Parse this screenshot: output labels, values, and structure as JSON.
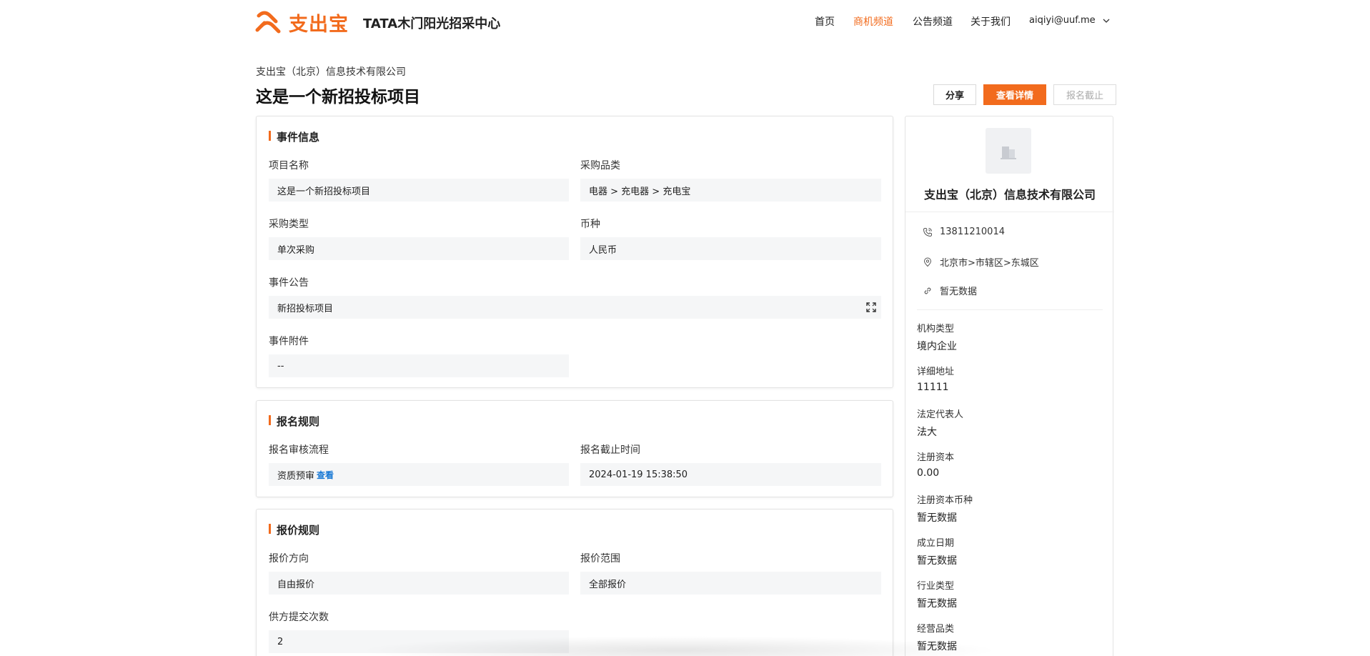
{
  "header": {
    "logo_text": "支出宝",
    "site_title": "TATA木门阳光招采中心",
    "nav": [
      {
        "label": "首页",
        "active": false
      },
      {
        "label": "商机频道",
        "active": true
      },
      {
        "label": "公告频道",
        "active": false
      },
      {
        "label": "关于我们",
        "active": false
      }
    ],
    "user": "aiqiyi@uuf.me",
    "accent_color": "#f26b1d"
  },
  "page": {
    "company": "支出宝（北京）信息技术有限公司",
    "title": "这是一个新招投标项目",
    "actions": {
      "share": "分享",
      "view_detail": "查看详情",
      "signup_closed": "报名截止"
    }
  },
  "event_info": {
    "title": "事件信息",
    "project_name_label": "项目名称",
    "project_name": "这是一个新招投标项目",
    "category_label": "采购品类",
    "category": "电器 > 充电器 > 充电宝",
    "purchase_type_label": "采购类型",
    "purchase_type": "单次采购",
    "currency_label": "币种",
    "currency": "人民币",
    "announcement_label": "事件公告",
    "announcement": "新招投标项目",
    "attachment_label": "事件附件",
    "attachment": "--"
  },
  "signup_rules": {
    "title": "报名规则",
    "review_label": "报名审核流程",
    "review": "资质预审",
    "review_link": "查看",
    "deadline_label": "报名截止时间",
    "deadline": "2024-01-19 15:38:50"
  },
  "quote_rules": {
    "title": "报价规则",
    "direction_label": "报价方向",
    "direction": "自由报价",
    "scope_label": "报价范围",
    "scope": "全部报价",
    "submit_times_label": "供方提交次数",
    "submit_times": "2"
  },
  "side": {
    "company": "支出宝（北京）信息技术有限公司",
    "phone": "13811210014",
    "region": "北京市>市辖区>东城区",
    "website": "暂无数据",
    "fields": [
      {
        "label": "机构类型",
        "value": "境内企业"
      },
      {
        "label": "详细地址",
        "value": "11111"
      },
      {
        "label": "法定代表人",
        "value": "法大"
      },
      {
        "label": "注册资本",
        "value": "0.00"
      },
      {
        "label": "注册资本币种",
        "value": "暂无数据"
      },
      {
        "label": "成立日期",
        "value": "暂无数据"
      },
      {
        "label": "行业类型",
        "value": "暂无数据"
      },
      {
        "label": "经营品类",
        "value": "暂无数据"
      }
    ]
  }
}
